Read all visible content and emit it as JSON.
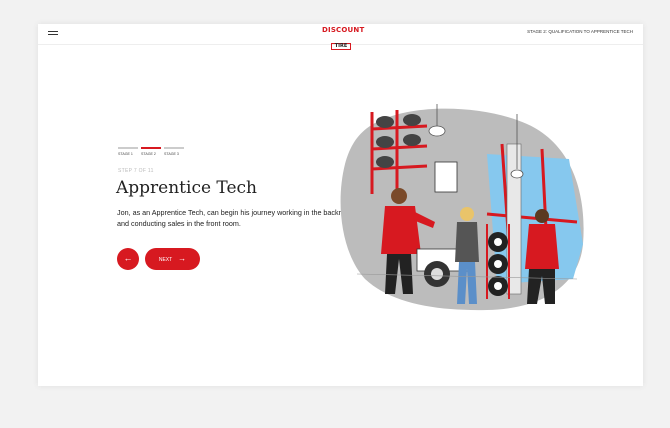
{
  "header": {
    "logo_line1": "DISCOUNT",
    "logo_line2": "TIRE",
    "stage_title": "STAGE 2: QUALIFICATION TO APPRENTICE TECH"
  },
  "progress": {
    "items": [
      {
        "label": "STAGE 1",
        "active": false
      },
      {
        "label": "STAGE 2",
        "active": true
      },
      {
        "label": "STAGE 3",
        "active": false
      }
    ]
  },
  "content": {
    "step": "STEP 7 OF 11",
    "title": "Apprentice Tech",
    "description": "Jon, as an Apprentice Tech, can begin his journey working in the backroom and conducting sales in the front room."
  },
  "buttons": {
    "back_icon": "←",
    "next_label": "NEXT",
    "next_icon": "→"
  },
  "colors": {
    "accent": "#d71920",
    "sky": "#86c8ee"
  }
}
